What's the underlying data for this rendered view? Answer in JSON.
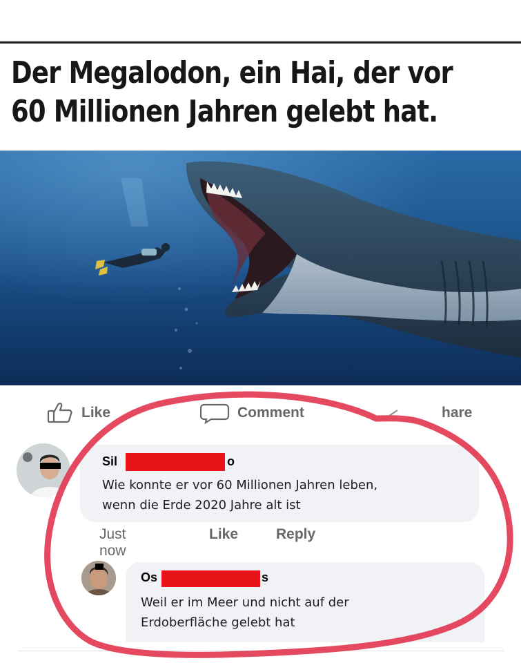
{
  "post": {
    "headline_line1": "Der Megalodon, ein Hai, der vor",
    "headline_line2": "60 Millionen Jahren gelebt hat."
  },
  "actions": {
    "like_label": "Like",
    "comment_label": "Comment",
    "share_label": "hare"
  },
  "comments": [
    {
      "author_start": "Sil",
      "author_end": "o",
      "text": "Wie konnte er vor 60 Millionen Jahren leben,\nwenn die Erde 2020 Jahre alt ist",
      "time": "Just now",
      "like_label": "Like",
      "reply_label": "Reply"
    },
    {
      "author_start": "Os",
      "author_end": "s",
      "text": "Weil er im Meer und nicht auf der\nErdoberfläche gelebt hat"
    }
  ],
  "colors": {
    "censor_bar": "#e8141a",
    "highlight_circle": "#e23a52",
    "ocean": "#1b4f86",
    "bubble": "#f0f2f5"
  }
}
